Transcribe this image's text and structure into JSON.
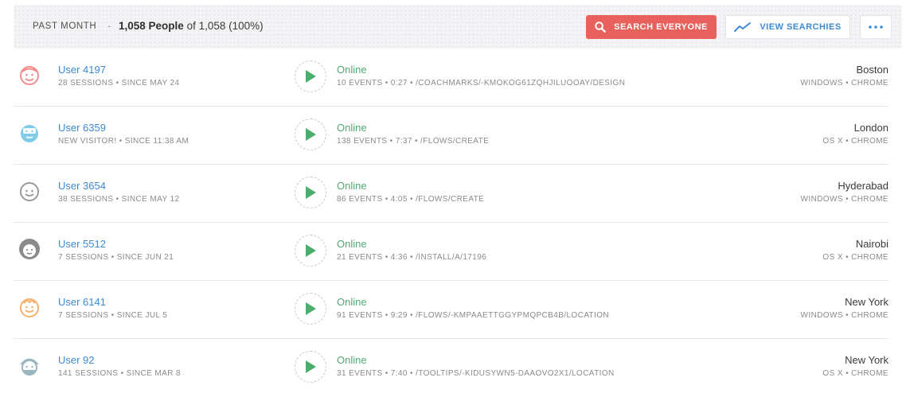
{
  "toolbar": {
    "range_label": "PAST MONTH",
    "separator": "·",
    "count_bold": "1,058 People",
    "count_rest": " of 1,058 (100%)",
    "search_label": "SEARCH EVERYONE",
    "views_label": "VIEW SEARCHIES",
    "more_icon": "more-dots-icon",
    "search_icon": "search-icon",
    "views_icon": "trend-line-icon"
  },
  "colors": {
    "accent_red": "#e8615c",
    "link_blue": "#3c8ad6",
    "online_green": "#52a874"
  },
  "users": [
    {
      "name": "User 4197",
      "meta": "28 SESSIONS • SINCE MAY 24",
      "status": "Online",
      "events": "10 EVENTS • 0:27 • /COACHMARKS/-KMOKOG61ZQHJILUOOAY/DESIGN",
      "city": "Boston",
      "platform": "WINDOWS • CHROME",
      "avatar": "pink-face-avatar-icon",
      "avatar_color": "#f28c8c"
    },
    {
      "name": "User 6359",
      "meta": "NEW VISITOR! • SINCE 11:38 AM",
      "status": "Online",
      "events": "138 EVENTS • 7:37 • /FLOWS/CREATE",
      "city": "London",
      "platform": "OS X • CHROME",
      "avatar": "bearded-face-avatar-icon",
      "avatar_color": "#7fcbe8"
    },
    {
      "name": "User 3654",
      "meta": "38 SESSIONS • SINCE MAY 12",
      "status": "Online",
      "events": "86 EVENTS • 4:05 • /FLOWS/CREATE",
      "city": "Hyderabad",
      "platform": "WINDOWS • CHROME",
      "avatar": "smiley-face-avatar-icon",
      "avatar_color": "#9a9a9a"
    },
    {
      "name": "User 5512",
      "meta": "7 SESSIONS • SINCE JUN 21",
      "status": "Online",
      "events": "21 EVENTS • 4:36 • /INSTALL/A/17196",
      "city": "Nairobi",
      "platform": "OS X • CHROME",
      "avatar": "curly-hair-avatar-icon",
      "avatar_color": "#8c8c8c"
    },
    {
      "name": "User 6141",
      "meta": "7 SESSIONS • SINCE JUL 5",
      "status": "Online",
      "events": "91 EVENTS • 9:29 • /FLOWS/-KMPAAETTGGYPMQPCB4B/LOCATION",
      "city": "New York",
      "platform": "WINDOWS • CHROME",
      "avatar": "orange-face-avatar-icon",
      "avatar_color": "#f5b06a"
    },
    {
      "name": "User 92",
      "meta": "141 SESSIONS • SINCE MAR 8",
      "status": "Online",
      "events": "31 EVENTS • 7:40 • /TOOLTIPS/-KIDUSYWN5-DAAOVO2X1/LOCATION",
      "city": "New York",
      "platform": "OS X • CHROME",
      "avatar": "turban-avatar-icon",
      "avatar_color": "#9ab7bf"
    }
  ]
}
